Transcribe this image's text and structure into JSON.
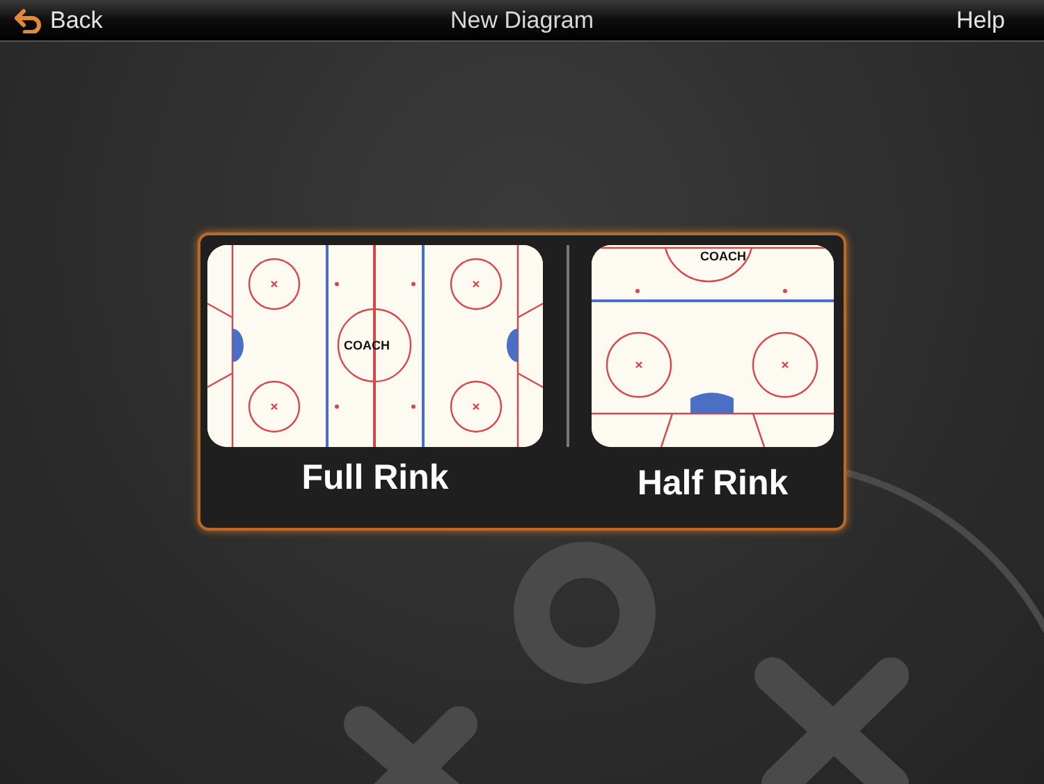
{
  "nav_bar": {
    "back": "Back",
    "title": "New Diagram",
    "help": "Help"
  },
  "options": [
    {
      "kind": "full",
      "label": "Full Rink",
      "logo_text": "COACH"
    },
    {
      "kind": "half",
      "label": "Half Rink",
      "logo_text": "COACH"
    }
  ]
}
